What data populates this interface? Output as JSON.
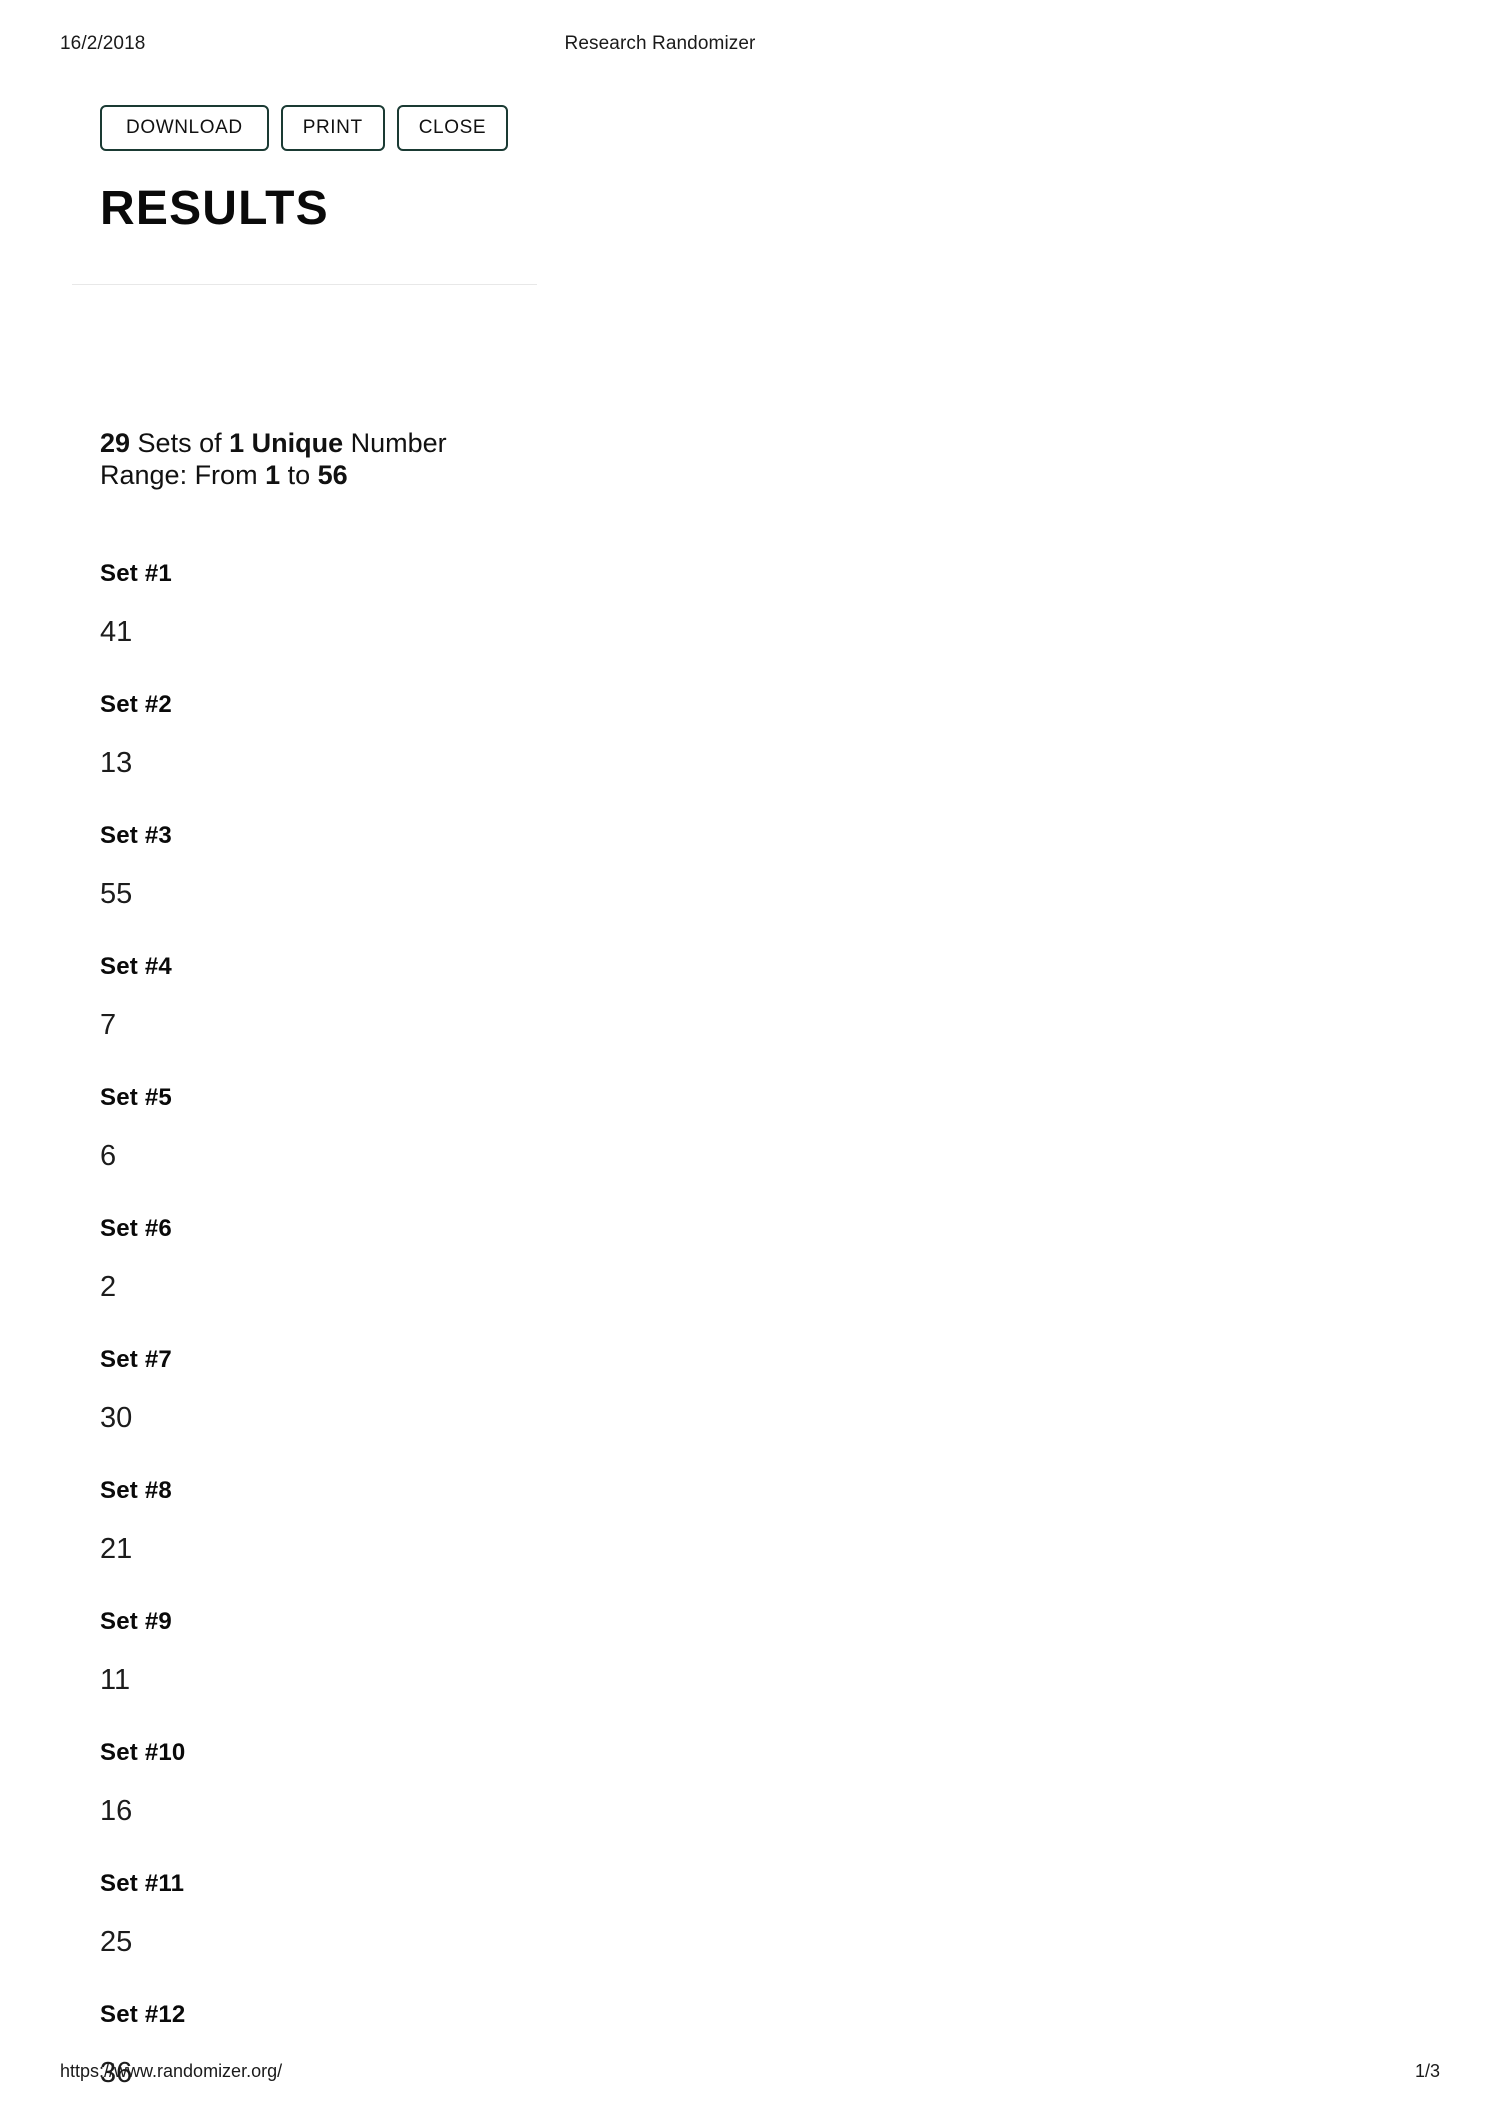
{
  "print_header": {
    "date": "16/2/2018",
    "title": "Research Randomizer"
  },
  "toolbar": {
    "download_label": "DOWNLOAD",
    "print_label": "PRINT",
    "close_label": "CLOSE",
    "border_color": "#1a3a33"
  },
  "page": {
    "heading": "RESULTS"
  },
  "summary": {
    "set_count": "29",
    "sets_of_text": " Sets of ",
    "per_set": "1 Unique",
    "number_word": " Number",
    "range_prefix": "Range: From ",
    "range_min": "1",
    "range_to": " to ",
    "range_max": "56",
    "full_line_1": "29 Sets of 1 Unique Number",
    "full_line_2": "Range: From 1 to 56"
  },
  "sets": [
    {
      "label": "Set #1",
      "value": "41"
    },
    {
      "label": "Set #2",
      "value": "13"
    },
    {
      "label": "Set #3",
      "value": "55"
    },
    {
      "label": "Set #4",
      "value": "7"
    },
    {
      "label": "Set #5",
      "value": "6"
    },
    {
      "label": "Set #6",
      "value": "2"
    },
    {
      "label": "Set #7",
      "value": "30"
    },
    {
      "label": "Set #8",
      "value": "21"
    },
    {
      "label": "Set #9",
      "value": "11"
    },
    {
      "label": "Set #10",
      "value": "16"
    },
    {
      "label": "Set #11",
      "value": "25"
    },
    {
      "label": "Set #12",
      "value": "36"
    }
  ],
  "print_footer": {
    "url": "https://www.randomizer.org/",
    "page_number": "1/3"
  }
}
